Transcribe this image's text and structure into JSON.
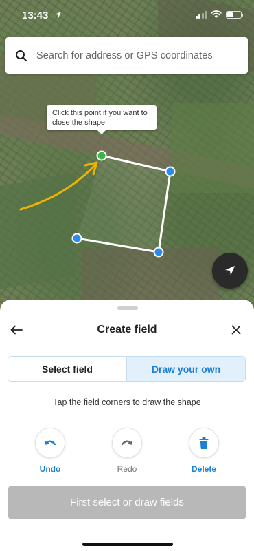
{
  "status_bar": {
    "time": "13:43"
  },
  "search": {
    "placeholder": "Search for address or GPS coordinates"
  },
  "map": {
    "tooltip": "Click this point if you want to close the shape",
    "colors": {
      "shape_outline": "#ffffff",
      "corner_point": "#2a8cf0",
      "start_point": "#3db54a",
      "arrow": "#f0b400"
    }
  },
  "sheet": {
    "title": "Create field",
    "tabs": [
      {
        "label": "Select field",
        "active": false
      },
      {
        "label": "Draw your own",
        "active": true
      }
    ],
    "instruction": "Tap the field corners to draw the shape",
    "actions": {
      "undo": {
        "label": "Undo",
        "enabled": true
      },
      "redo": {
        "label": "Redo",
        "enabled": false
      },
      "delete": {
        "label": "Delete",
        "enabled": true
      }
    },
    "primary_button": "First select or draw fields"
  },
  "colors": {
    "accent": "#1a7fd6",
    "disabled_button": "#b8b8b8"
  }
}
